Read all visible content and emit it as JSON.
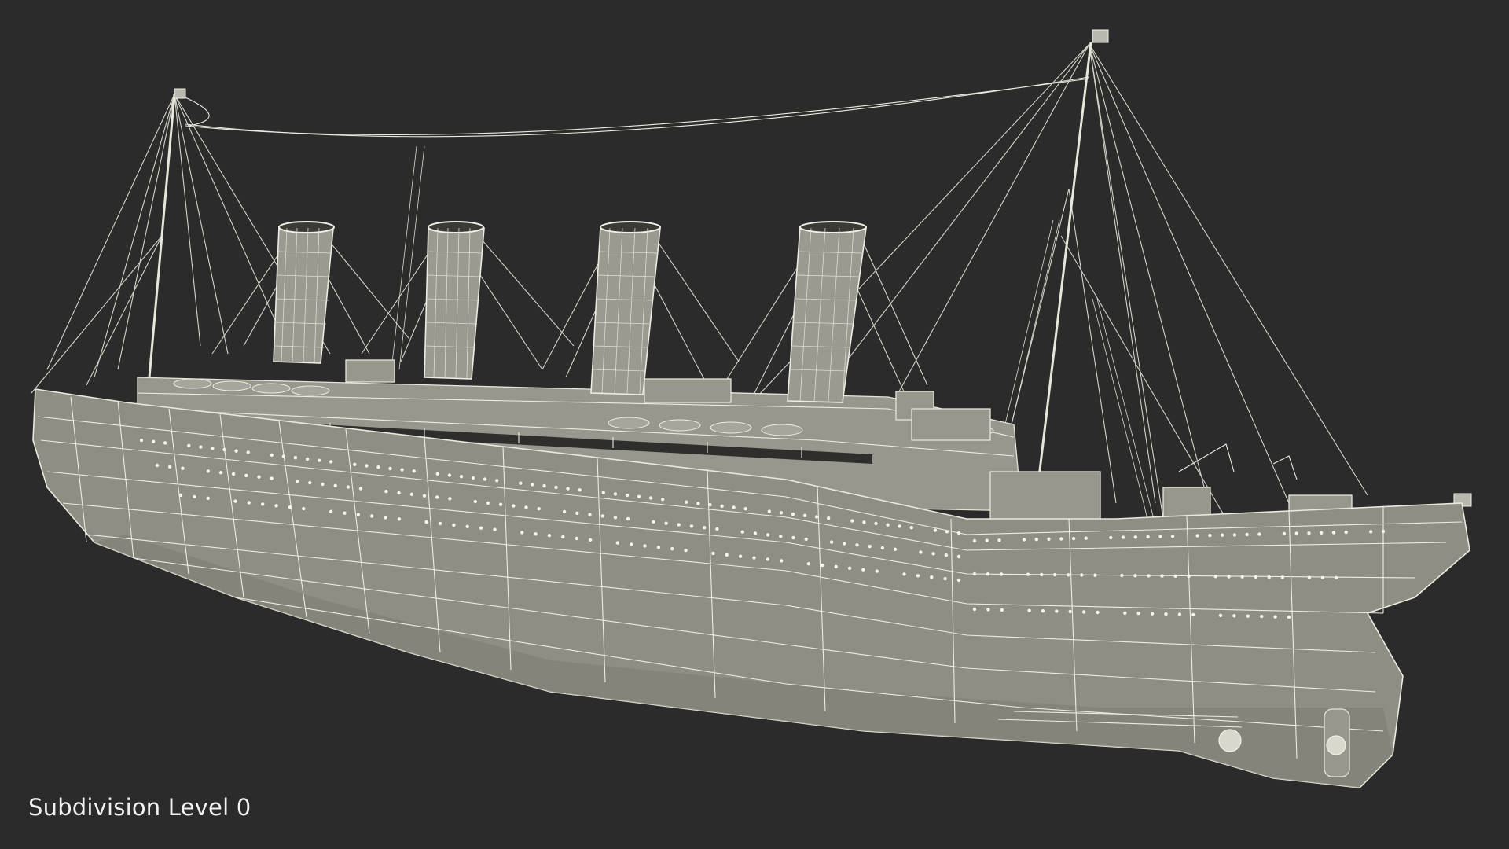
{
  "viewport": {
    "background": "#2b2b2b",
    "caption": "Subdivision Level 0"
  },
  "model": {
    "render_style": "wireframe-over-shaded",
    "wire_color": "#ecece2",
    "surface_color": "#8e8e84"
  }
}
